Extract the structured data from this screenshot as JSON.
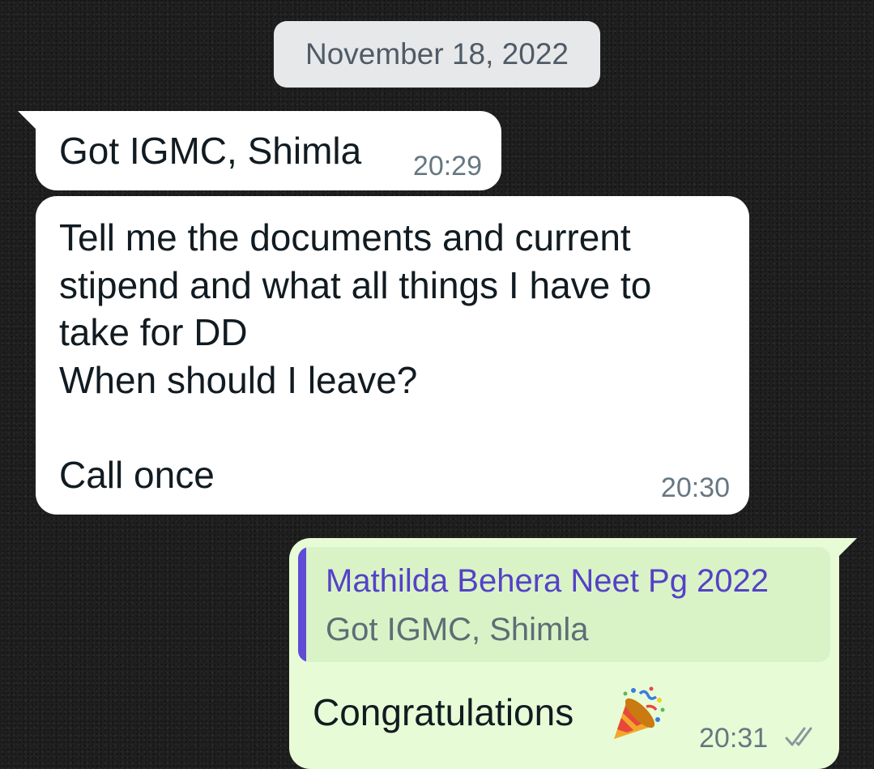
{
  "date_chip": "November 18, 2022",
  "messages": [
    {
      "direction": "incoming",
      "text": "Got IGMC, Shimla",
      "time": "20:29"
    },
    {
      "direction": "incoming",
      "text": "Tell me the documents and current stipend and what all things I have to take for DD\nWhen should I leave?\n\nCall once",
      "time": "20:30"
    },
    {
      "direction": "outgoing",
      "reply_to": {
        "author": "Mathilda Behera Neet Pg 2022",
        "text": "Got IGMC, Shimla"
      },
      "text": "Congratulations",
      "emoji_icon": "party-popper-icon",
      "time": "20:31",
      "status_icon": "double-check-icon"
    }
  ],
  "colors": {
    "incoming_bubble": "#ffffff",
    "outgoing_bubble": "#e7fcd6",
    "quote_background": "#d9f3c7",
    "quote_bar": "#5f4bd6",
    "quote_author": "#5541c7",
    "timestamp": "#667781",
    "date_chip_background": "#e6e8ea"
  }
}
